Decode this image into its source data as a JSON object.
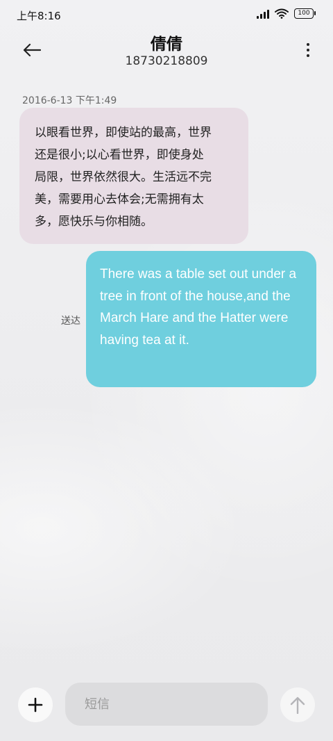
{
  "status_bar": {
    "time": "上午8:16",
    "battery": "100"
  },
  "header": {
    "contact_name": "倩倩",
    "phone_number": "18730218809"
  },
  "conversation": {
    "timestamp": "2016-6-13 下午1:49",
    "messages": [
      {
        "direction": "incoming",
        "text": "以眼看世界，即使站的最高，世界\n还是很小;以心看世界，即使身处\n局限，世界依然很大。生活远不完\n美，需要用心去体会;无需拥有太\n多，愿快乐与你相随。"
      },
      {
        "direction": "outgoing",
        "text": "There was a table set out under a tree in front of the house,and the March Hare and the Hatter were having tea at it.",
        "status": "送达"
      }
    ]
  },
  "composer": {
    "placeholder": "短信",
    "value": ""
  },
  "colors": {
    "incoming_bubble": "#e8dde5",
    "outgoing_bubble": "#6fcfde"
  }
}
